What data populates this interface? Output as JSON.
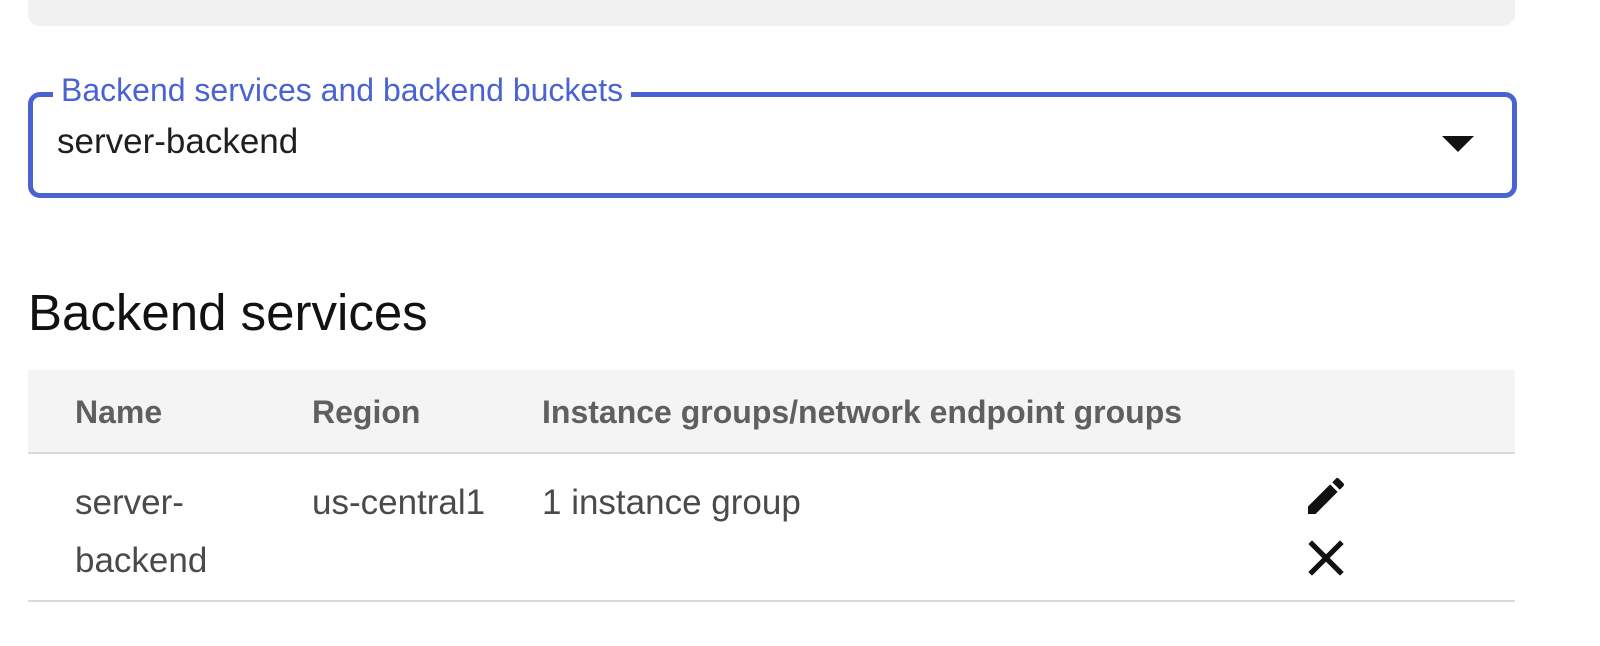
{
  "backend_select": {
    "label": "Backend services and backend buckets",
    "value": "server-backend",
    "accent_color": "#4a63d3"
  },
  "section": {
    "title": "Backend services"
  },
  "table": {
    "headers": {
      "name": "Name",
      "region": "Region",
      "groups": "Instance groups/network endpoint groups"
    },
    "rows": [
      {
        "name": "server-backend",
        "region": "us-central1",
        "groups": "1 instance group"
      }
    ]
  },
  "icons": {
    "dropdown": "triangle-down-icon",
    "edit": "pencil-icon",
    "delete": "close-icon"
  }
}
